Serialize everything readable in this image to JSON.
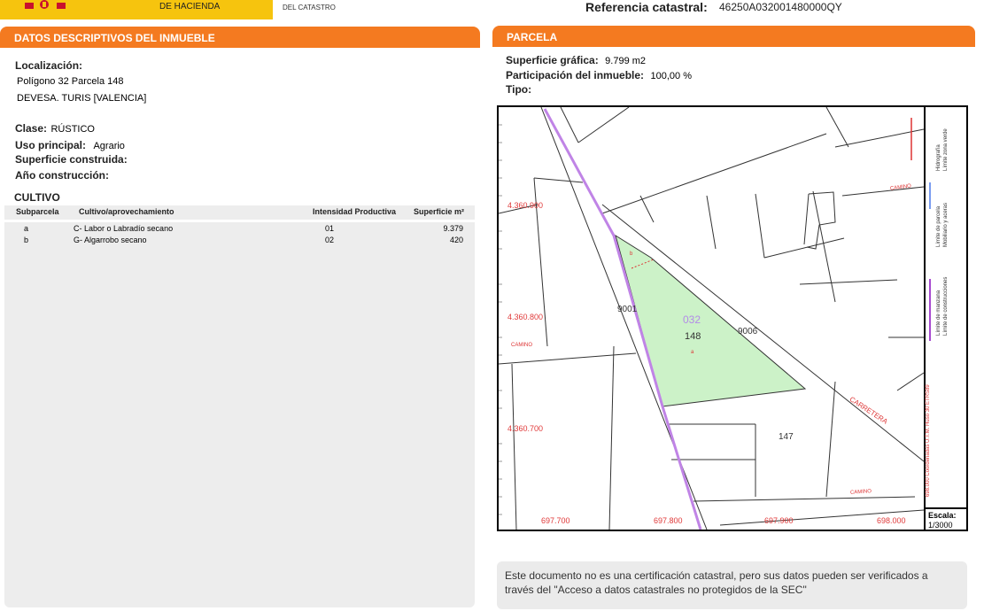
{
  "header": {
    "ministry": "DE HACIENDA",
    "office": "DEL CATASTRO",
    "ref_label": "Referencia catastral:",
    "ref_value": "46250A032001480000QY"
  },
  "left": {
    "title": "DATOS DESCRIPTIVOS DEL INMUEBLE",
    "loc_label": "Localización:",
    "loc_line1": "Polígono 32 Parcela 148",
    "loc_line2": "DEVESA. TURIS [VALENCIA]",
    "clase_label": "Clase:",
    "clase_value": "RÚSTICO",
    "uso_label": "Uso principal:",
    "uso_value": "Agrario",
    "sup_label": "Superficie construida:",
    "anio_label": "Año construcción:",
    "cultivo_title": "CULTIVO",
    "cultivo_headers": [
      "Subparcela",
      "Cultivo/aprovechamiento",
      "Intensidad Productiva",
      "Superficie m²"
    ],
    "cultivo_rows": [
      [
        "a",
        "C- Labor o Labradío secano",
        "01",
        "9.379"
      ],
      [
        "b",
        "G- Algarrobo secano",
        "02",
        "420"
      ]
    ]
  },
  "right": {
    "title": "PARCELA",
    "supg_label": "Superficie gráfica:",
    "supg_value": "9.799 m2",
    "part_label": "Participación del inmueble:",
    "part_value": "100,00 %",
    "tipo_label": "Tipo:"
  },
  "map": {
    "y_labels": [
      "4.360.900",
      "4.360.800",
      "4.360.700"
    ],
    "x_labels": [
      "697.700",
      "697.800",
      "697.900",
      "698.000"
    ],
    "poligono": "032",
    "parcela": "148",
    "sub_a": "a",
    "sub_b": "b",
    "p9001": "9001",
    "p9006": "9006",
    "p147": "147",
    "camino": "CAMINO",
    "carretera": "CARRETERA",
    "legend": [
      "Límite de manzana",
      "Límite de construcciones",
      "Límite de parcela",
      "Mobiliario y aceras",
      "Hidrografía",
      "Límite zona verde"
    ],
    "coord_note": "698.000 Coordenadas U.T.M. Huso 30 ETRS89",
    "escala_label": "Escala:",
    "escala_value": "1/3000"
  },
  "note": {
    "line1": "Este documento no es una certificación catastral, pero sus datos pueden ser verificados a",
    "line2": "través del \"Acceso a datos catastrales no protegidos de la SEC\""
  },
  "colors": {
    "orange": "#f47a20",
    "parcel_fill": "#ccf2c8",
    "road_purple": "#c084e6",
    "red_text": "#e03a3a"
  }
}
